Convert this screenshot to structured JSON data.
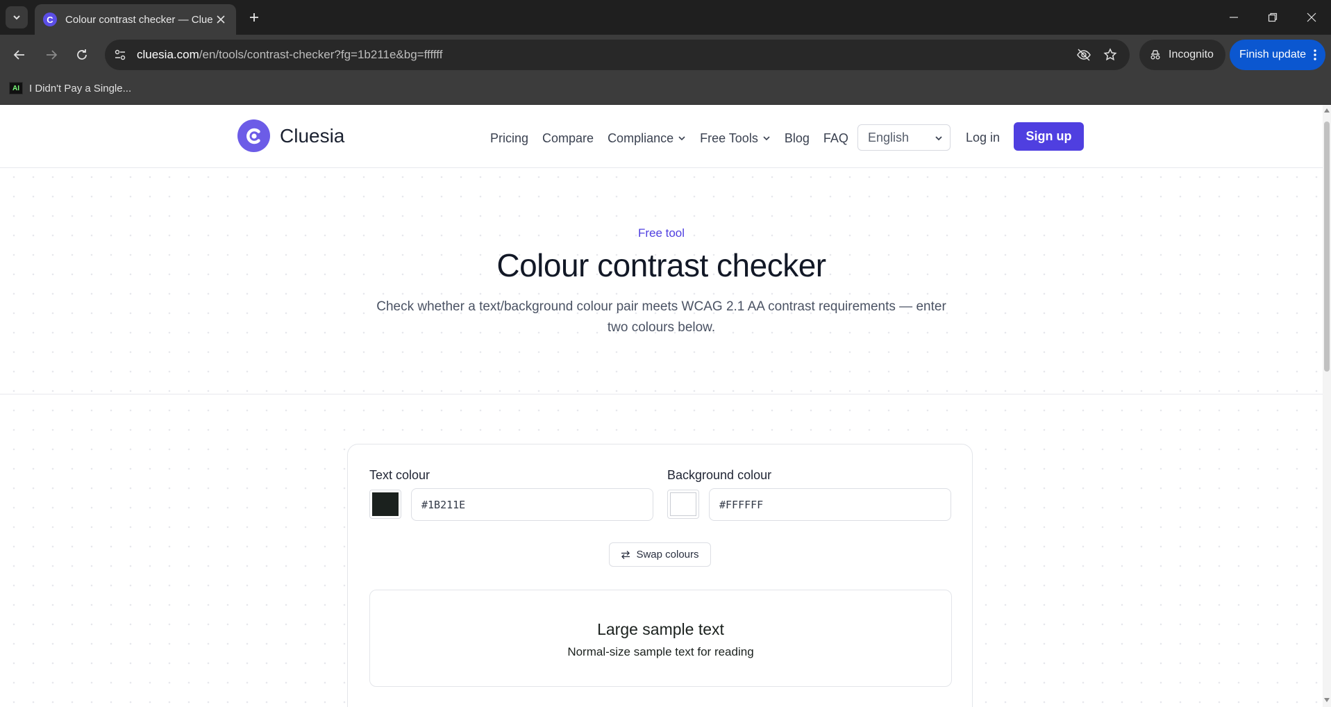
{
  "browser": {
    "tab_title": "Colour contrast checker — Cluesia",
    "url_host": "cluesia.com",
    "url_path": "/en/tools/contrast-checker?fg=1b211e&bg=ffffff",
    "incognito_label": "Incognito",
    "finish_update_label": "Finish update",
    "bookmark_icon_text": "AI",
    "bookmark_label": "I Didn't Pay a Single..."
  },
  "header": {
    "brand": "Cluesia",
    "nav": {
      "pricing": "Pricing",
      "compare": "Compare",
      "compliance": "Compliance",
      "free_tools": "Free Tools",
      "blog": "Blog",
      "faq": "FAQ"
    },
    "language": "English",
    "login": "Log in",
    "signup": "Sign up"
  },
  "hero": {
    "eyebrow": "Free tool",
    "title": "Colour contrast checker",
    "subtitle": "Check whether a text/background colour pair meets WCAG 2.1 AA contrast requirements — enter two colours below."
  },
  "checker": {
    "text_colour_label": "Text colour",
    "text_colour_value": "#1B211E",
    "background_colour_label": "Background colour",
    "background_colour_value": "#FFFFFF",
    "swap_label": "Swap colours",
    "large_sample": "Large sample text",
    "normal_sample": "Normal-size sample text for reading"
  },
  "colors": {
    "brand": "#4f3fe0",
    "logo": "#6c5ce7",
    "foreground": "#1b211e",
    "background": "#ffffff"
  },
  "icons": {
    "tab_list": "chevron-down-icon",
    "close": "close-icon",
    "new_tab": "plus-icon",
    "back": "arrow-left-icon",
    "forward": "arrow-right-icon",
    "reload": "reload-icon",
    "site_settings": "tune-icon",
    "eye_off": "eye-off-icon",
    "bookmark_star": "star-icon",
    "swap": "swap-icon"
  }
}
